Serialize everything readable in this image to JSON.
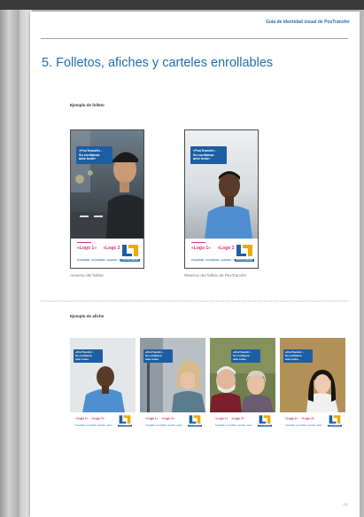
{
  "document": {
    "header_title": "Guía de identidad visual de PosTransfer",
    "section_title": "5. Folletos, afiches y carteles enrollables",
    "page_number": "13"
  },
  "brochure_section": {
    "heading": "Ejemplo de folleto",
    "front_caption": "Anverso del folleto",
    "back_caption": "Reverso del folleto de PosTransfer"
  },
  "poster_section": {
    "heading": "Ejemplo de afiche"
  },
  "piece": {
    "slogan": "«PosTransfer -\nSu confianza\nante todo»",
    "logo_1": "«Logo 1»",
    "logo_2": "«Logo 2»",
    "tagline": "Tranquilidad · accesibilidad · seguridad · rapidez",
    "brand_name": "POSTRANSFER"
  },
  "colors": {
    "brand_blue": "#1d5ea3",
    "accent_magenta": "#d6337e"
  }
}
